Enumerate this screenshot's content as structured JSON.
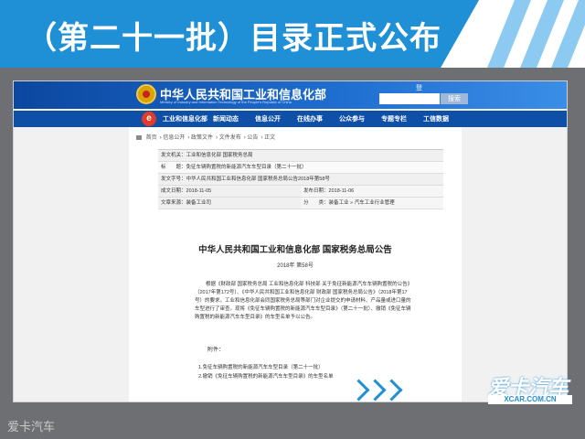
{
  "banner": {
    "title": "（第二十一批）目录正式公布"
  },
  "site": {
    "name": "中华人民共和国工业和信息化部",
    "subtitle": "Ministry of Industry and Information Technology of the People's Republic of China",
    "login": "登",
    "search_placeholder": "",
    "search_label": "搜索",
    "nav": [
      "工业和信息化部",
      "新闻动态",
      "信息公开",
      "在线办事",
      "公众参与",
      "专题专栏",
      "工信数据"
    ]
  },
  "breadcrumb": [
    "首页",
    "信息公开",
    "政策文件",
    "文件发布",
    "公告",
    "正文"
  ],
  "meta": {
    "issuer_label": "发文机关：",
    "issuer": "工业和信息化部 国家税务总局",
    "title_label": "标　　题：",
    "title": "免征车辆购置税的新能源汽车车型目录（第二十一批）",
    "docno_label": "发文字号：",
    "docno": "中华人民共和国工业和信息化部 国家税务总局公告2018年第58号",
    "created_label": "成文日期：",
    "created": "2018-11-05",
    "published_label": "发布日期：",
    "published": "2018-11-06",
    "maker_label": "文章来源：",
    "maker": "装备工业司",
    "category_label": "分　　类：",
    "category": "装备工业 » 汽车工业行业管理"
  },
  "document": {
    "heading": "中华人民共和国工业和信息化部 国家税务总局公告",
    "number": "2018年 第58号",
    "paragraph": "根据《财政部 国家税务总局 工业和信息化部 科技部 关于免征新能源汽车车辆购置税的公告》（2017年第172号）、《中华人民共和国工业和信息化部 财政部 国家税务总局公告》（2018年第17号）的要求，工业和信息化部会同国家税务总局等部门对企业提交的申请材料、产品量或进口量的车型进行了审查。现将《免征车辆购置税的新能源汽车车型目录》（第二十一批）、撤销《免征车辆购置税的新能源汽车车型目录》的车型名单予以公告。",
    "attachments_label": "附件：",
    "attachments": [
      "1.免征车辆购置税的新能源汽车车型目录（第二十一批）",
      "2.撤销《免征车辆购置税的新能源汽车车型目录》的车型名单"
    ]
  },
  "watermark": "爱卡汽车",
  "logo": {
    "main": "爱卡汽车",
    "url": "XCAR.COM.CN"
  },
  "colors": {
    "brand_blue": "#1f8fd6",
    "site_blue": "#0e4fa8",
    "home_red": "#e23b2b"
  }
}
